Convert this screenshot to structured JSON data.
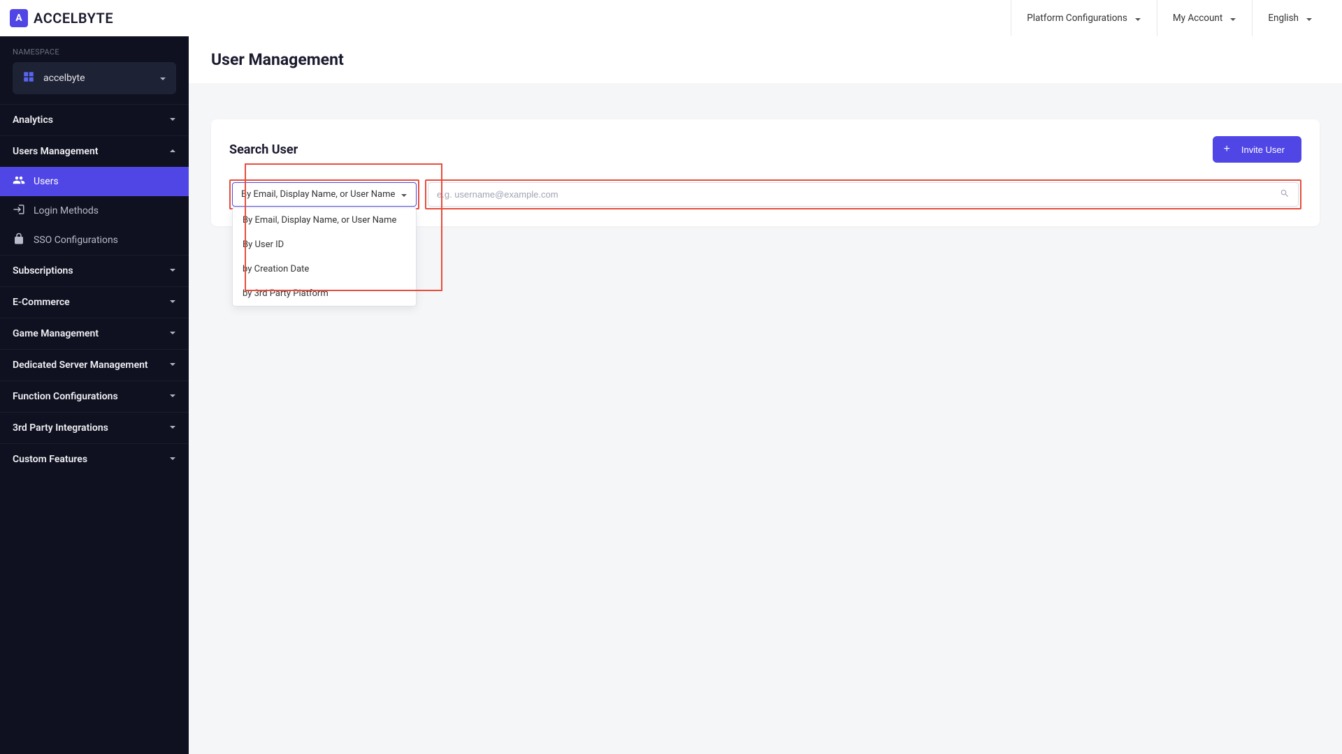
{
  "brand": {
    "name": "ACCELBYTE",
    "logo_letter": "A"
  },
  "header": {
    "menus": [
      {
        "label": "Platform Configurations"
      },
      {
        "label": "My Account"
      },
      {
        "label": "English"
      }
    ]
  },
  "sidebar": {
    "namespace_label": "NAMESPACE",
    "namespace_value": "accelbyte",
    "sections": [
      {
        "label": "Analytics",
        "expanded": false,
        "subitems": []
      },
      {
        "label": "Users Management",
        "expanded": true,
        "subitems": [
          {
            "label": "Users",
            "icon": "users",
            "active": true
          },
          {
            "label": "Login Methods",
            "icon": "login",
            "active": false
          },
          {
            "label": "SSO Configurations",
            "icon": "lock",
            "active": false
          }
        ]
      },
      {
        "label": "Subscriptions",
        "expanded": false,
        "subitems": []
      },
      {
        "label": "E-Commerce",
        "expanded": false,
        "subitems": []
      },
      {
        "label": "Game Management",
        "expanded": false,
        "subitems": []
      },
      {
        "label": "Dedicated Server Management",
        "expanded": false,
        "subitems": []
      },
      {
        "label": "Function Configurations",
        "expanded": false,
        "subitems": []
      },
      {
        "label": "3rd Party Integrations",
        "expanded": false,
        "subitems": []
      },
      {
        "label": "Custom Features",
        "expanded": false,
        "subitems": []
      }
    ]
  },
  "page": {
    "title": "User Management"
  },
  "card": {
    "title": "Search User",
    "invite_label": "Invite User",
    "dropdown_selected": "By Email, Display Name, or User Name",
    "dropdown_options": [
      "By Email, Display Name, or User Name",
      "By User ID",
      "by Creation Date",
      "by 3rd Party Platform"
    ],
    "search_placeholder": "e.g. username@example.com"
  }
}
